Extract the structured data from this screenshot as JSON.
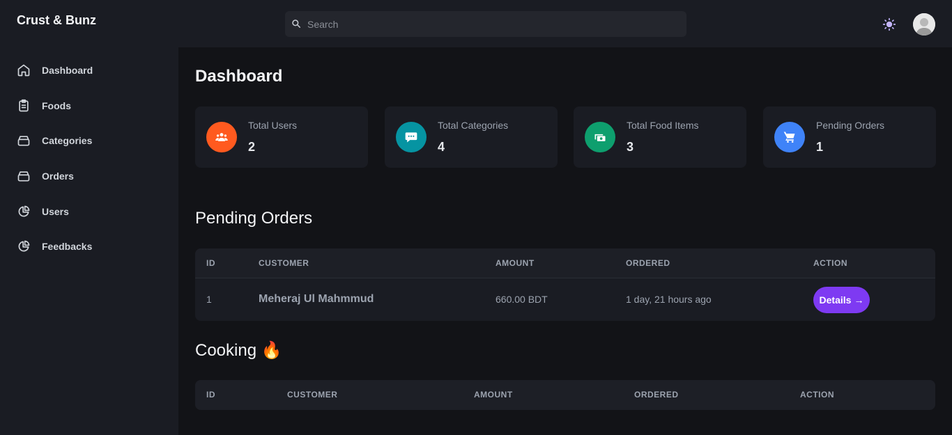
{
  "brand": "Crust & Bunz",
  "search": {
    "placeholder": "Search"
  },
  "sidebar": {
    "items": [
      {
        "label": "Dashboard",
        "icon": "home-icon"
      },
      {
        "label": "Foods",
        "icon": "clipboard-icon"
      },
      {
        "label": "Categories",
        "icon": "archive-icon"
      },
      {
        "label": "Orders",
        "icon": "archive-icon"
      },
      {
        "label": "Users",
        "icon": "pie-chart-icon"
      },
      {
        "label": "Feedbacks",
        "icon": "pie-chart-icon"
      }
    ]
  },
  "page": {
    "title": "Dashboard"
  },
  "cards": [
    {
      "label": "Total Users",
      "value": "2",
      "color": "#ff5a1f",
      "icon": "users-icon"
    },
    {
      "label": "Total Categories",
      "value": "4",
      "color": "#0694a2",
      "icon": "chat-icon"
    },
    {
      "label": "Total Food Items",
      "value": "3",
      "color": "#0e9f6e",
      "icon": "cash-icon"
    },
    {
      "label": "Pending Orders",
      "value": "1",
      "color": "#3f83f8",
      "icon": "cart-icon"
    }
  ],
  "pending": {
    "title": "Pending Orders",
    "headers": [
      "ID",
      "CUSTOMER",
      "AMOUNT",
      "ORDERED",
      "ACTION"
    ],
    "rows": [
      {
        "id": "1",
        "customer": "Meheraj Ul Mahmmud",
        "amount": "660.00 BDT",
        "ordered": "1 day, 21 hours ago",
        "action": "Details"
      }
    ]
  },
  "cooking": {
    "title": "Cooking 🔥",
    "headers": [
      "ID",
      "CUSTOMER",
      "AMOUNT",
      "ORDERED",
      "ACTION"
    ]
  },
  "colors": {
    "accent": "#7e3af2",
    "sidebar": "#1a1c23",
    "background": "#121317"
  }
}
